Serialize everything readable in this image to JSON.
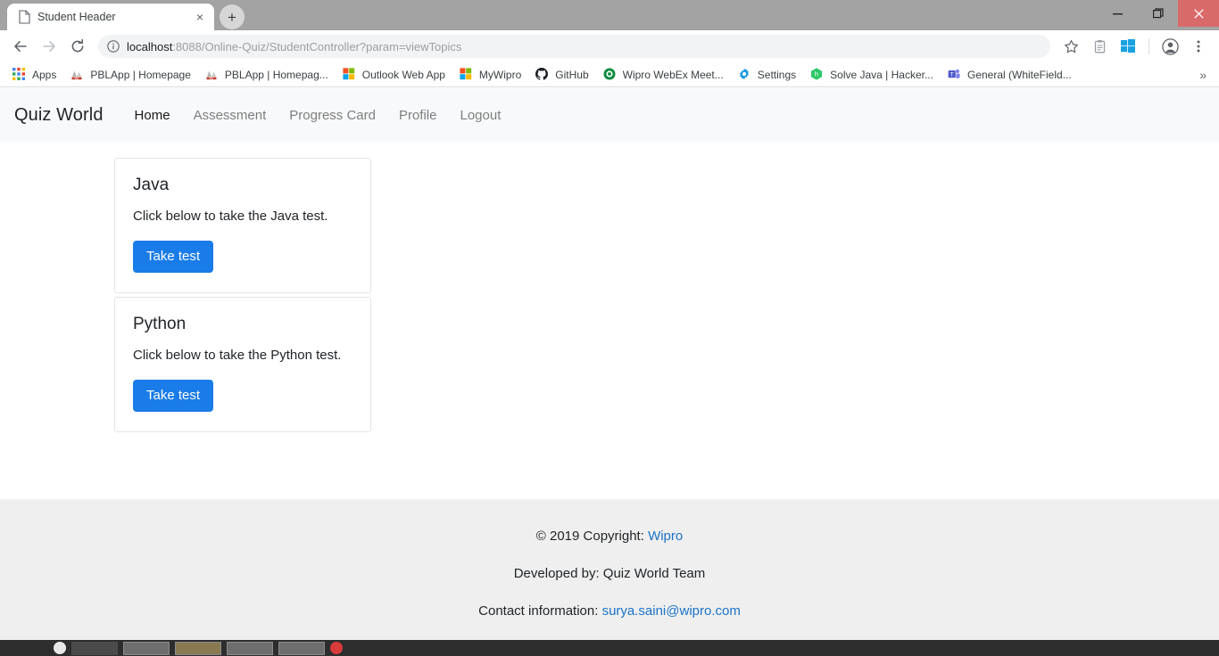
{
  "browser": {
    "tab": {
      "title": "Student Header",
      "favicon_name": "page-icon",
      "close_label": "×"
    },
    "new_tab_label": "+",
    "window_controls": {
      "minimize": "—",
      "maximize": "❐",
      "close": "×"
    },
    "toolbar": {
      "back": "←",
      "forward": "→",
      "reload": "⟳",
      "url": "localhost:8088/Online-Quiz/StudentController?param=viewTopics",
      "url_host": "localhost",
      "url_rest": ":8088/Online-Quiz/StudentController?param=viewTopics",
      "bookmark_star": "☆",
      "menu": "⋮"
    },
    "bookmarks": [
      {
        "label": "Apps",
        "icon": "apps-grid-icon"
      },
      {
        "label": "PBLApp | Homepage",
        "icon": "pbl-icon"
      },
      {
        "label": "PBLApp | Homepag...",
        "icon": "pbl-icon"
      },
      {
        "label": "Outlook Web App",
        "icon": "microsoft-squares-icon"
      },
      {
        "label": "MyWipro",
        "icon": "microsoft-squares-icon"
      },
      {
        "label": "GitHub",
        "icon": "github-icon"
      },
      {
        "label": "Wipro WebEx Meet...",
        "icon": "webex-icon"
      },
      {
        "label": "Settings",
        "icon": "gear-icon"
      },
      {
        "label": "Solve Java | Hacker...",
        "icon": "hackerrank-icon"
      },
      {
        "label": "General (WhiteField...",
        "icon": "teams-icon"
      }
    ],
    "bookmarks_overflow": "»"
  },
  "navbar": {
    "brand": "Quiz World",
    "links": [
      {
        "label": "Home",
        "active": true
      },
      {
        "label": "Assessment",
        "active": false
      },
      {
        "label": "Progress Card",
        "active": false
      },
      {
        "label": "Profile",
        "active": false
      },
      {
        "label": "Logout",
        "active": false
      }
    ]
  },
  "main": {
    "cards": [
      {
        "title": "Java",
        "text": "Click below to take the Java test.",
        "button": "Take test"
      },
      {
        "title": "Python",
        "text": "Click below to take the Python test.",
        "button": "Take test"
      }
    ]
  },
  "footer": {
    "copyright_prefix": "© 2019 Copyright: ",
    "copyright_link": "Wipro",
    "developed_by": "Developed by: Quiz World Team",
    "contact_prefix": "Contact information: ",
    "contact_link": "surya.saini@wipro.com"
  },
  "colors": {
    "accent_button": "#1a7ce8",
    "navbar_bg": "#f8f9fa",
    "footer_bg": "#efefef",
    "link": "#1a73c8"
  }
}
